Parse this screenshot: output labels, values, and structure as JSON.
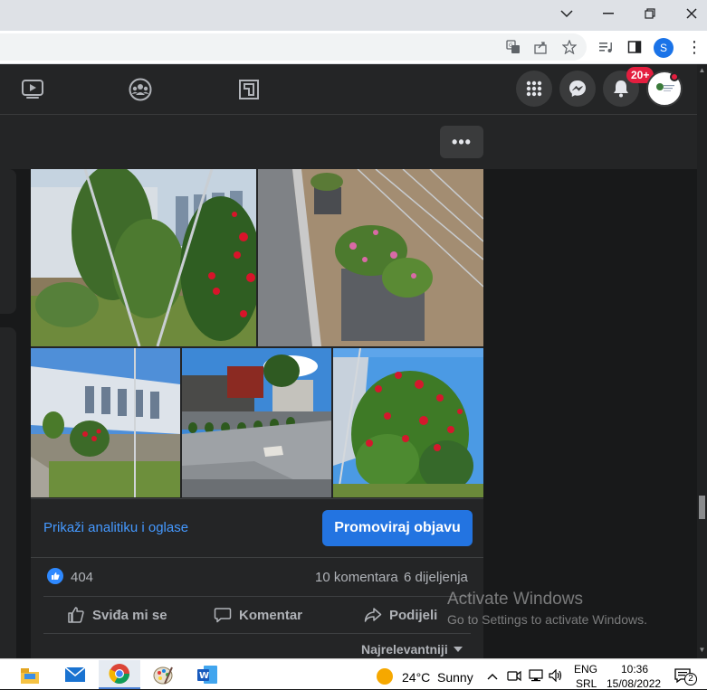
{
  "browser": {
    "window_controls": {
      "minimize": "—",
      "maximize": "▢",
      "close": "✕",
      "chevron": "⌄"
    },
    "profile_initial": "S",
    "address_icons": [
      "translate-icon",
      "share-icon",
      "star-icon",
      "reading-list-icon",
      "side-panel-icon"
    ],
    "menu": "⋮"
  },
  "fb_nav": {
    "notifications_badge": "20+",
    "more_button": "•••"
  },
  "post": {
    "analytics_link": "Prikaži analitiku i oglase",
    "promote_button": "Promoviraj objavu",
    "like_count": "404",
    "comments": "10 komentara",
    "shares": "6 dijeljenja",
    "actions": {
      "like": "Sviđa mi se",
      "comment": "Komentar",
      "share": "Podijeli"
    },
    "sort": "Najrelevantniji"
  },
  "watermark": {
    "title": "Activate Windows",
    "subtitle": "Go to Settings to activate Windows."
  },
  "taskbar": {
    "temperature": "24°C",
    "condition": "Sunny",
    "lang_top": "ENG",
    "lang_bottom": "SRL",
    "time": "10:36",
    "date": "15/08/2022",
    "notification_count": "2"
  },
  "colors": {
    "fb_dark": "#18191a",
    "card": "#242526",
    "accent_blue": "#2374e1",
    "link_blue": "#4599ff",
    "badge_red": "#e41e3f"
  }
}
